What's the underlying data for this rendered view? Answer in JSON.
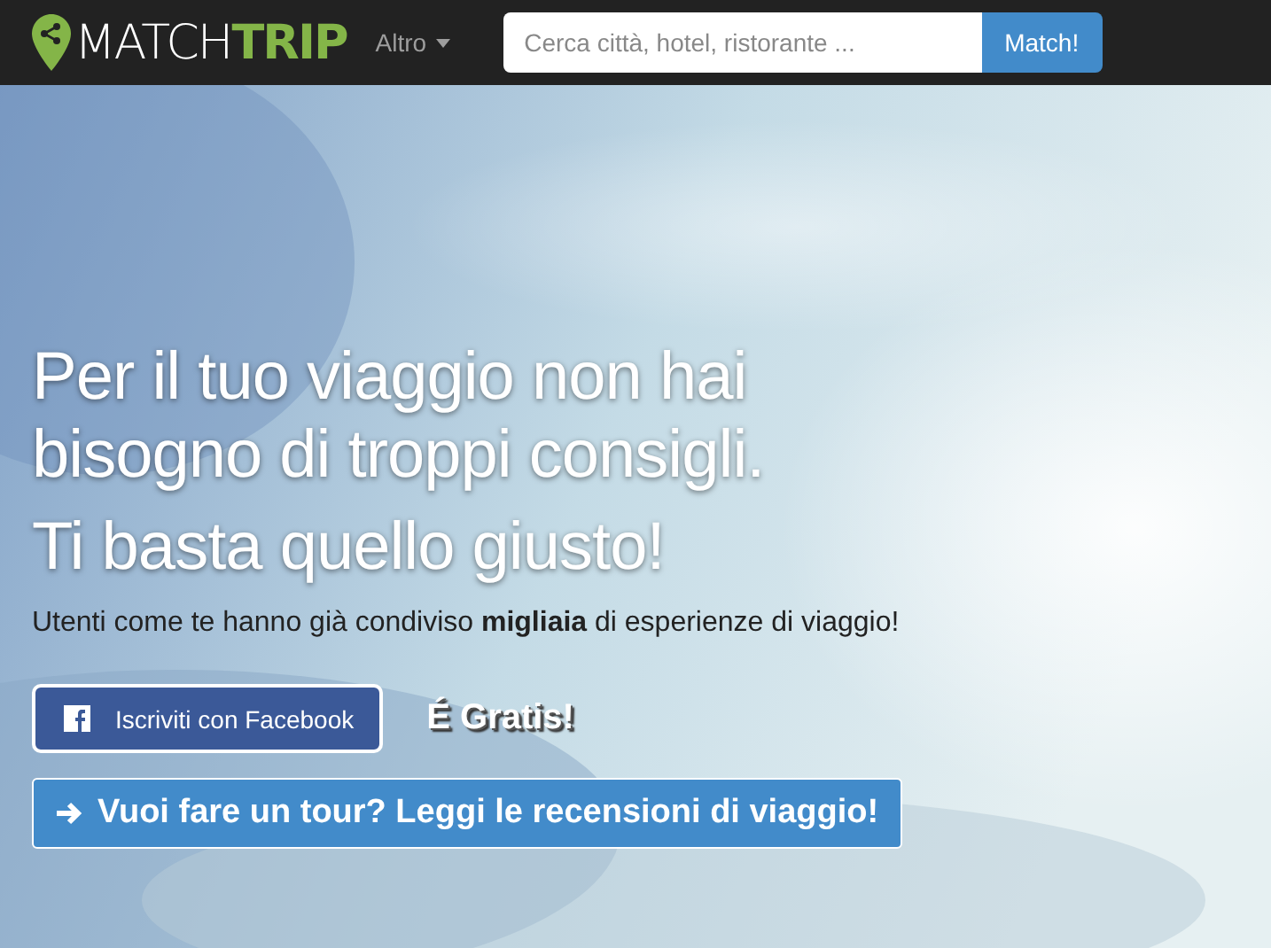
{
  "navbar": {
    "logo": {
      "first": "MATCH",
      "second": "TRIP"
    },
    "menu": {
      "label": "Altro"
    },
    "search": {
      "placeholder": "Cerca città, hotel, ristorante ...",
      "button": "Match!"
    }
  },
  "hero": {
    "headline": [
      "Per il tuo viaggio non hai",
      "bisogno di troppi consigli."
    ],
    "subheadline": "Ti basta quello giusto!",
    "tagline": "Utenti come te hanno già condiviso **migliaia** di esperienze di viaggio!",
    "facebook_button": "Iscriviti con Facebook",
    "free_note": "É Gratis!",
    "tour_button": "Vuoi fare un tour? Leggi le recensioni di viaggio!"
  }
}
